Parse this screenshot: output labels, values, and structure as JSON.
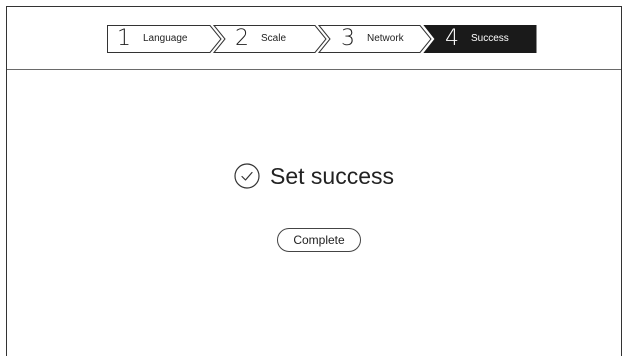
{
  "steps": [
    {
      "number": "1",
      "label": "Language",
      "state": "done"
    },
    {
      "number": "2",
      "label": "Scale",
      "state": "done"
    },
    {
      "number": "3",
      "label": "Network",
      "state": "done"
    },
    {
      "number": "4",
      "label": "Success",
      "state": "active"
    }
  ],
  "result": {
    "icon": "check-circle-icon",
    "message": "Set success"
  },
  "complete_button": {
    "label": "Complete"
  },
  "colors": {
    "active_step_bg": "#1a1a1a",
    "active_step_text": "#ffffff",
    "border": "#333333",
    "text": "#222222"
  }
}
